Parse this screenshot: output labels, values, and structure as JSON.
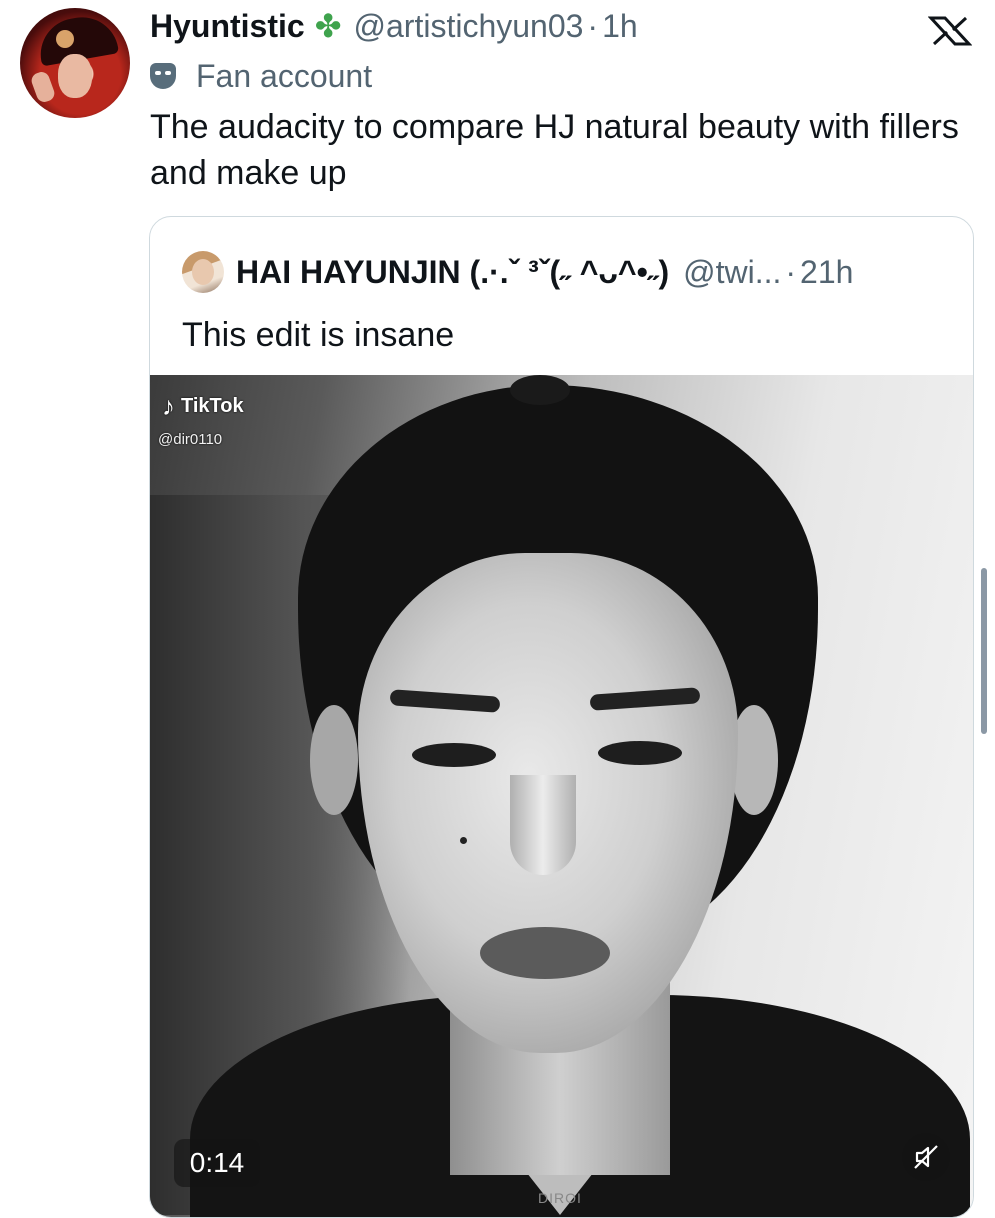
{
  "author": {
    "display_name": "Hyuntistic",
    "badge_icon": "four-leaf-clover",
    "handle": "@artistichyun03",
    "separator": "·",
    "time_ago": "1h",
    "account_label": "Fan account",
    "account_label_icon": "theater-mask-icon"
  },
  "tweet": {
    "text": "The audacity to compare HJ natural beauty with fillers and make up"
  },
  "brand": {
    "logo": "x-logo"
  },
  "quoted_tweet": {
    "display_name": "HAI HAYUNJIN (.·.ˇ ³ˇ(˶ ^ᴗ^•˶)",
    "handle": "@twi...",
    "separator": "·",
    "time_ago": "21h",
    "text": "This edit is insane",
    "video": {
      "duration": "0:14",
      "overlay_app": "TikTok",
      "overlay_user": "@dir0110",
      "watermark": "DIROI"
    }
  },
  "colors": {
    "text_primary": "#0f1419",
    "text_secondary": "#536471",
    "border": "#cfd9de",
    "clover": "#3fa34d"
  }
}
